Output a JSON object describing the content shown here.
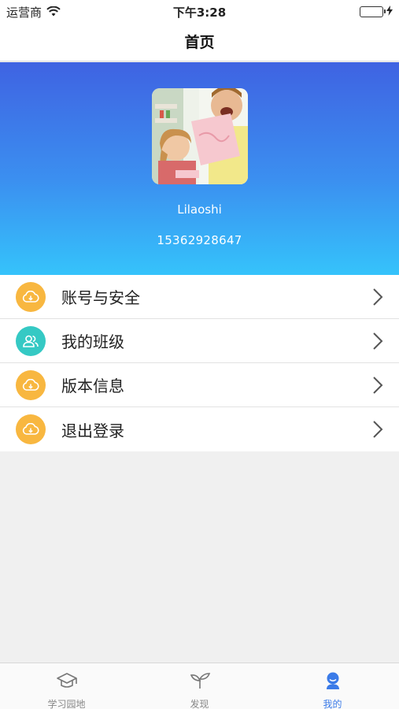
{
  "status_bar": {
    "carrier": "运营商",
    "time": "下午3:28"
  },
  "nav": {
    "title": "首页"
  },
  "profile": {
    "username": "Lilaoshi",
    "phone": "15362928647"
  },
  "menu": [
    {
      "label": "账号与安全",
      "icon": "cloud-download-icon",
      "color": "#f8b740"
    },
    {
      "label": "我的班级",
      "icon": "group-icon",
      "color": "#35c9c4"
    },
    {
      "label": "版本信息",
      "icon": "cloud-download-icon",
      "color": "#f8b740"
    },
    {
      "label": "退出登录",
      "icon": "cloud-download-icon",
      "color": "#f8b740"
    }
  ],
  "tabs": [
    {
      "label": "学习园地",
      "icon": "graduation-cap-icon",
      "active": false
    },
    {
      "label": "发现",
      "icon": "sprout-icon",
      "active": false
    },
    {
      "label": "我的",
      "icon": "person-icon",
      "active": true
    }
  ],
  "colors": {
    "accent": "#3b7be8",
    "header_top": "#3f63e2",
    "header_bottom": "#35c3fb"
  }
}
